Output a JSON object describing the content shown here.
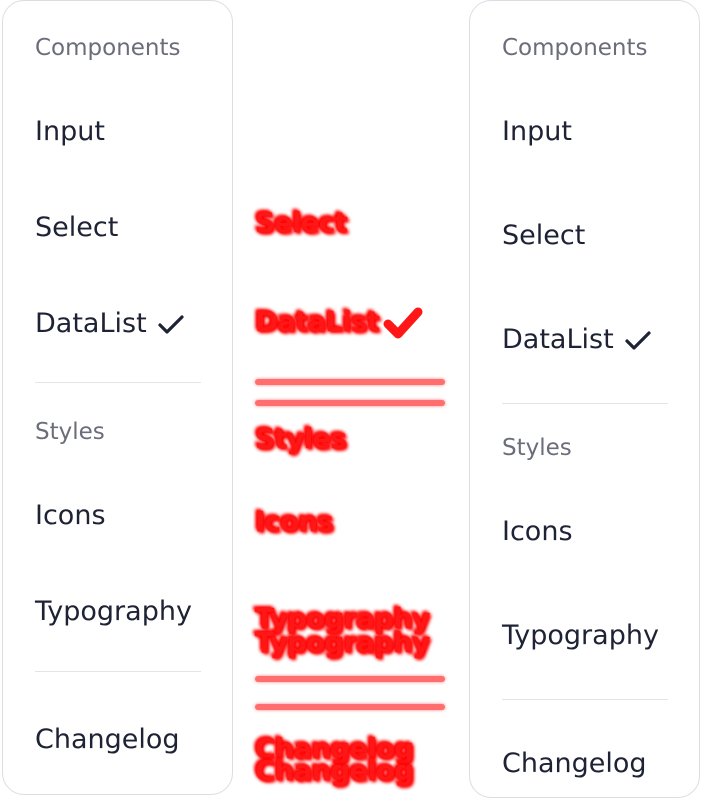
{
  "left_menu": {
    "sections": {
      "components_heading": "Components",
      "styles_heading": "Styles"
    },
    "items": {
      "input": "Input",
      "select": "Select",
      "datalist": "DataList",
      "icons": "Icons",
      "typography": "Typography",
      "changelog": "Changelog"
    },
    "selected": "DataList"
  },
  "diff_overlay": {
    "items": {
      "select": "Select",
      "datalist": "DataList",
      "styles": "Styles",
      "icons": "Icons",
      "typography": "Typography",
      "changelog": "Changelog"
    },
    "color": "#ff0000"
  },
  "right_menu": {
    "sections": {
      "components_heading": "Components",
      "styles_heading": "Styles"
    },
    "items": {
      "input": "Input",
      "select": "Select",
      "datalist": "DataList",
      "icons": "Icons",
      "typography": "Typography",
      "changelog": "Changelog"
    },
    "selected": "DataList"
  },
  "colors": {
    "text": "#1e2235",
    "heading": "#6b6d7a",
    "border": "#dcdde3",
    "diff": "#ff0000"
  },
  "icons": [
    "check-icon"
  ]
}
